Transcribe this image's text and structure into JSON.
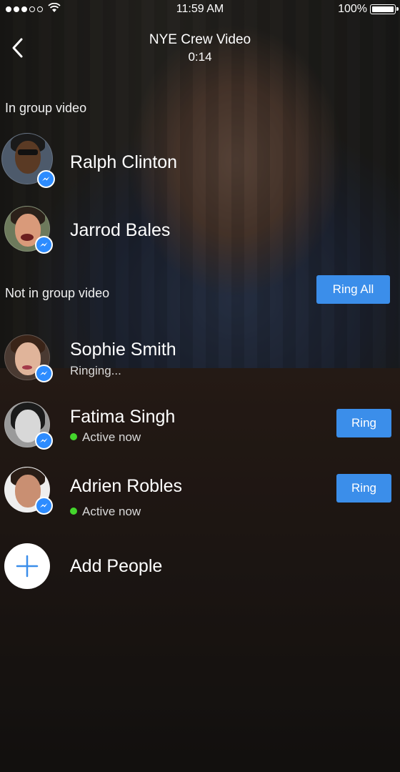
{
  "status_bar": {
    "time": "11:59 AM",
    "battery": "100%",
    "signal_bars_filled": 3,
    "signal_bars_total": 5
  },
  "header": {
    "title": "NYE Crew Video",
    "timer": "0:14",
    "back_icon": "chevron-left-icon"
  },
  "in_group": {
    "label": "In group video",
    "people": [
      {
        "name": "Ralph Clinton"
      },
      {
        "name": "Jarrod Bales"
      }
    ]
  },
  "not_in_group": {
    "label": "Not in group video",
    "ring_all_label": "Ring All",
    "people": [
      {
        "name": "Sophie Smith",
        "status": "Ringing..."
      },
      {
        "name": "Fatima Singh",
        "status": "Active now",
        "ring_label": "Ring"
      },
      {
        "name": "Adrien Robles",
        "status": "Active now",
        "ring_label": "Ring"
      }
    ]
  },
  "add_people": {
    "label": "Add People",
    "icon": "plus-icon"
  },
  "colors": {
    "accent": "#3b8eea",
    "messenger_badge": "#2d8cff",
    "active_dot": "#44d62c"
  }
}
